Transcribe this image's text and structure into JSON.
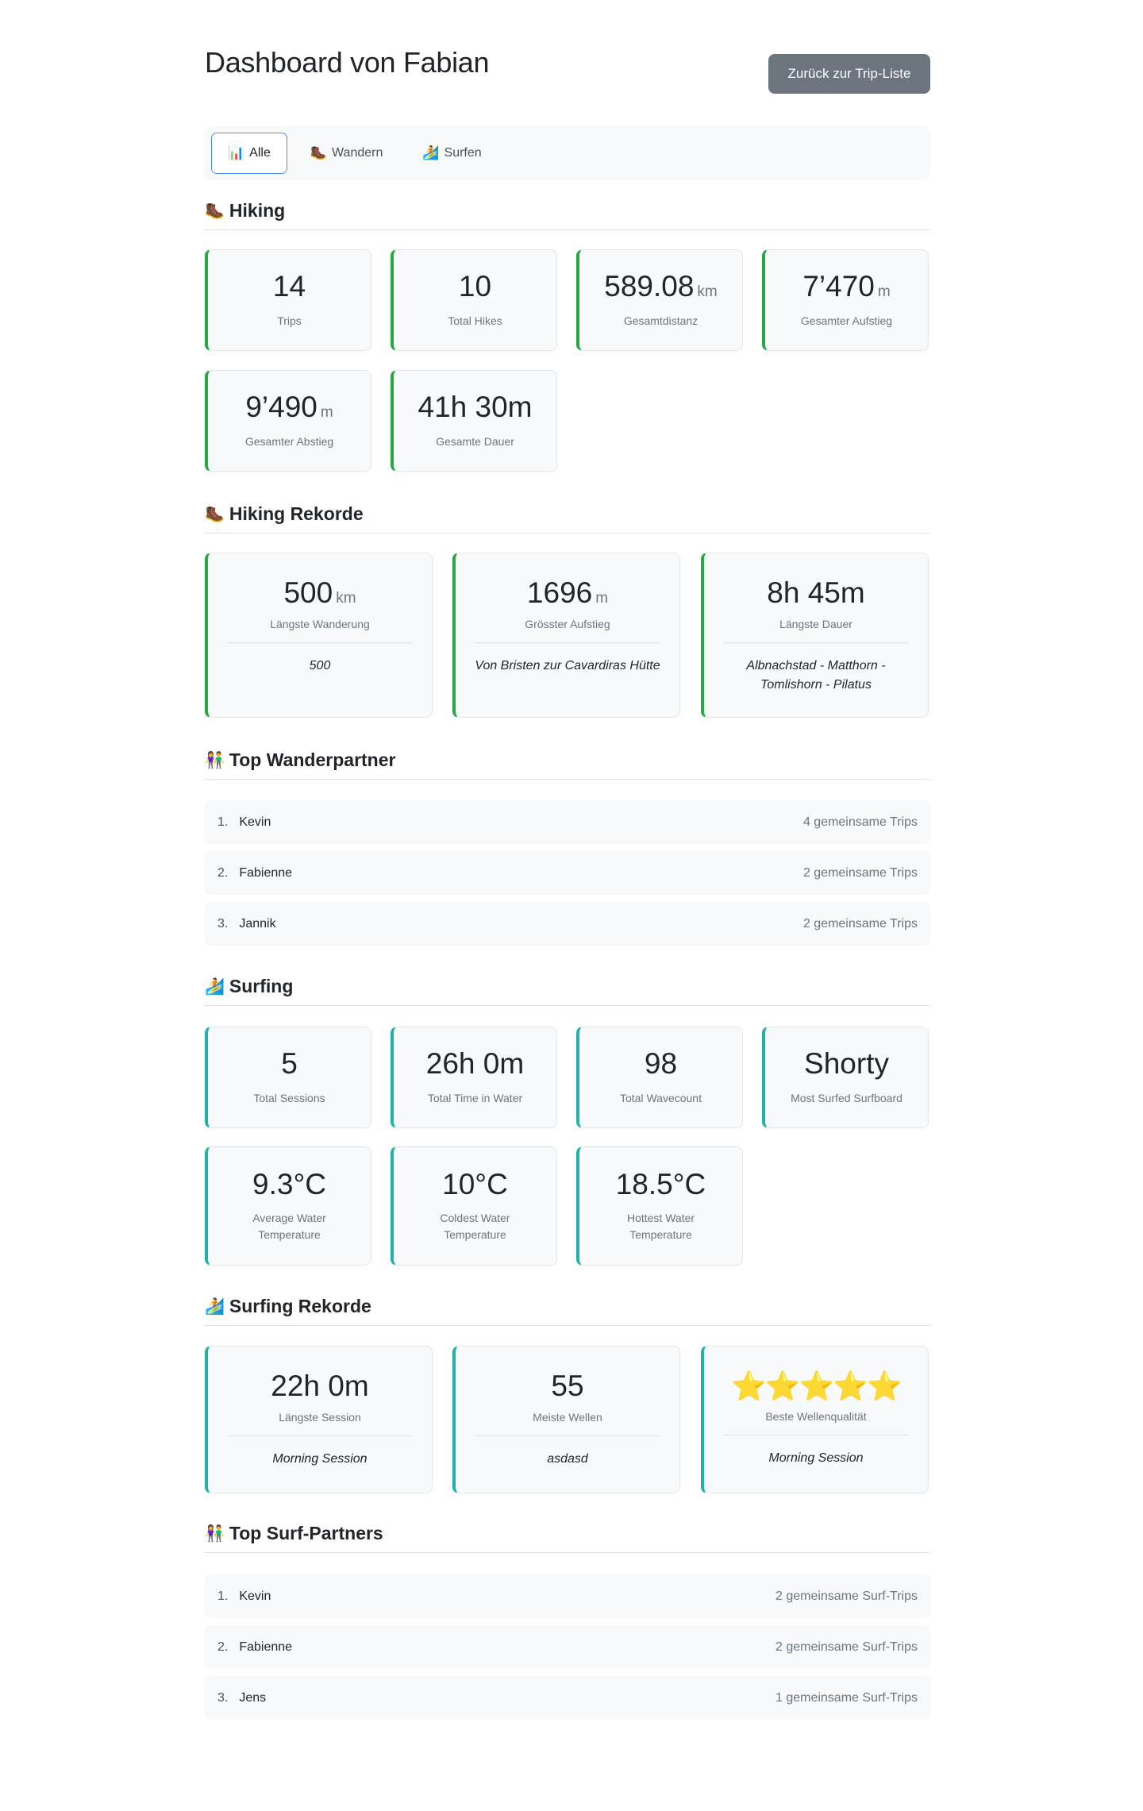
{
  "header": {
    "title": "Dashboard von Fabian",
    "back_label": "Zurück zur Trip-Liste"
  },
  "tabs": [
    {
      "icon": "📊",
      "label": "Alle"
    },
    {
      "icon": "🥾",
      "label": "Wandern"
    },
    {
      "icon": "🏄",
      "label": "Surfen"
    }
  ],
  "hiking": {
    "icon": "🥾",
    "title": "Hiking",
    "stats": [
      {
        "value": "14",
        "unit": "",
        "label": "Trips"
      },
      {
        "value": "10",
        "unit": "",
        "label": "Total Hikes"
      },
      {
        "value": "589.08",
        "unit": "km",
        "label": "Gesamtdistanz"
      },
      {
        "value": "7’470",
        "unit": "m",
        "label": "Gesamter Aufstieg"
      },
      {
        "value": "9’490",
        "unit": "m",
        "label": "Gesamter Abstieg"
      },
      {
        "value": "41h 30m",
        "unit": "",
        "label": "Gesamte Dauer"
      }
    ]
  },
  "hiking_records": {
    "icon": "🥾",
    "title": "Hiking Rekorde",
    "records": [
      {
        "value": "500",
        "unit": "km",
        "label": "Längste Wanderung",
        "name": "500"
      },
      {
        "value": "1696",
        "unit": "m",
        "label": "Grösster Aufstieg",
        "name": "Von Bristen zur Cavardiras Hütte"
      },
      {
        "value": "8h 45m",
        "unit": "",
        "label": "Längste Dauer",
        "name": "Albnachstad - Matthorn - Tomlishorn - Pilatus"
      }
    ]
  },
  "hiking_partners": {
    "icon": "👫",
    "title": "Top Wanderpartner",
    "items": [
      {
        "rank": "1.",
        "name": "Kevin",
        "count": "4 gemeinsame Trips"
      },
      {
        "rank": "2.",
        "name": "Fabienne",
        "count": "2 gemeinsame Trips"
      },
      {
        "rank": "3.",
        "name": "Jannik",
        "count": "2 gemeinsame Trips"
      }
    ]
  },
  "surfing": {
    "icon": "🏄",
    "title": "Surfing",
    "stats": [
      {
        "value": "5",
        "label": "Total Sessions"
      },
      {
        "value": "26h 0m",
        "label": "Total Time in Water"
      },
      {
        "value": "98",
        "label": "Total Wavecount"
      },
      {
        "value": "Shorty",
        "label": "Most Surfed Surfboard"
      },
      {
        "value": "9.3°C",
        "label": "Average Water Temperature"
      },
      {
        "value": "10°C",
        "label": "Coldest Water Temperature"
      },
      {
        "value": "18.5°C",
        "label": "Hottest Water Temperature"
      }
    ]
  },
  "surfing_records": {
    "icon": "🏄",
    "title": "Surfing Rekorde",
    "records": [
      {
        "value": "22h 0m",
        "label": "Längste Session",
        "name": "Morning Session"
      },
      {
        "value": "55",
        "label": "Meiste Wellen",
        "name": "asdasd"
      },
      {
        "value": "⭐⭐⭐⭐⭐",
        "rating": 5,
        "label": "Beste Wellenqualität",
        "name": "Morning Session"
      }
    ]
  },
  "surf_partners": {
    "icon": "👫",
    "title": "Top Surf-Partners",
    "items": [
      {
        "rank": "1.",
        "name": "Kevin",
        "count": "2 gemeinsame Surf-Trips"
      },
      {
        "rank": "2.",
        "name": "Fabienne",
        "count": "2 gemeinsame Surf-Trips"
      },
      {
        "rank": "3.",
        "name": "Jens",
        "count": "1 gemeinsame Surf-Trips"
      }
    ]
  },
  "colors": {
    "hiking_accent": "#28a745",
    "surf_accent": "#20b2aa",
    "active_tab_border": "#4a8df8",
    "back_button": "#6c757d"
  }
}
